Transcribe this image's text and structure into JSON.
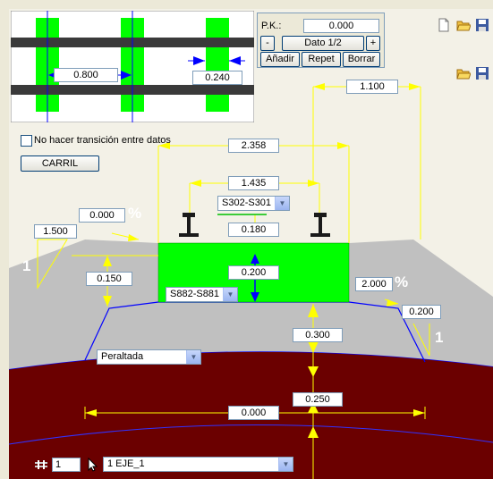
{
  "colors": {
    "ballast": "#c0c0c0",
    "sleeper": "#00ff00",
    "subgrade": "#6b0000",
    "dimension": "#ffff00",
    "arrow_blue": "#0000ff"
  },
  "plan": {
    "sleeper_spacing": "0.800",
    "sleeper_width": "0.240"
  },
  "pk_panel": {
    "pk_label": "P.K.:",
    "pk_value": "0.000",
    "prev_label": "-",
    "dato_label": "Dato 1/2",
    "next_label": "+",
    "add_label": "Añadir",
    "repeat_label": "Repet",
    "delete_label": "Borrar"
  },
  "options": {
    "no_transition_label": "No hacer transición entre datos",
    "carril_button": "CARRIL"
  },
  "dims": {
    "top_right": "1.100",
    "total_width": "2.358",
    "gauge": "1.435",
    "rail_type": "S302-S301",
    "rail_height": "0.180",
    "left_slope_pct": "0.000",
    "left_shoulder": "1.500",
    "left_depth": "0.150",
    "sleeper_height": "0.200",
    "sleeper_type": "S882-S881",
    "right_slope_pct": "2.000",
    "pct_symbol": "%",
    "right_shoulder": "0.200",
    "ballast_depth": "0.300",
    "subballast_depth": "0.250",
    "cant_mode": "Peraltada",
    "offset": "0.000",
    "ratio_one": "1"
  },
  "bottom": {
    "axis_number": "1",
    "axis_select": "1 EJE_1"
  },
  "icons": [
    "new-file-icon",
    "open-folder-icon",
    "save-icon",
    "open-folder-icon",
    "save-icon",
    "axis-icon",
    "cursor-icon"
  ]
}
